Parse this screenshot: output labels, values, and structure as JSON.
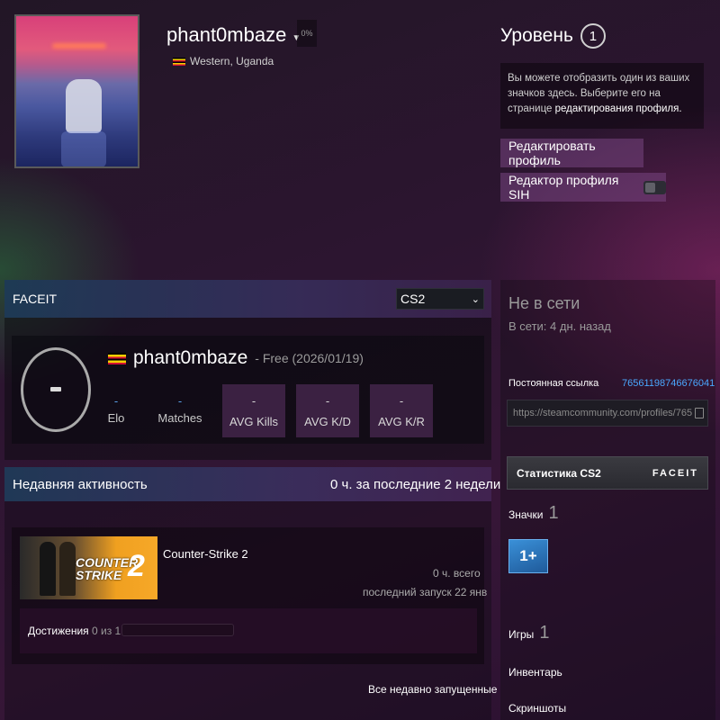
{
  "header": {
    "username": "phant0mbaze",
    "percent": "0%",
    "location": "Western, Uganda",
    "level_label": "Уровень",
    "level_value": "1",
    "badge_note": "Вы можете отобразить один из ваших значков здесь. Выберите его на странице",
    "badge_note_link": "редактирования профиля.",
    "edit_profile_button": "Редактировать профиль",
    "sih_editor_button": "Редактор профиля SIH"
  },
  "faceit": {
    "title": "FACEIT",
    "game_select": "CS2",
    "name": "phant0mbaze",
    "subtitle": "- Free (2026/01/19)",
    "stats": [
      {
        "label": "Elo",
        "value": "-"
      },
      {
        "label": "Matches",
        "value": "-"
      }
    ],
    "stat_boxes": [
      {
        "label": "AVG Kills",
        "value": "-"
      },
      {
        "label": "AVG K/D",
        "value": "-"
      },
      {
        "label": "AVG K/R",
        "value": "-"
      }
    ]
  },
  "recent": {
    "title": "Недавняя активность",
    "hours": "0 ч. за последние 2 недели",
    "game": {
      "name": "Counter-Strike 2",
      "capsule_text_1": "COUNTER",
      "capsule_text_2": "STRIKE",
      "capsule_num": "2",
      "total": "0 ч. всего",
      "last_played": "последний запуск 22 янв",
      "achievements_label": "Достижения",
      "achievements_count": "0 из 1",
      "achievements_progress": 0
    },
    "all_recent_link": "Все недавно запущенные"
  },
  "sidebar": {
    "status": "Не в сети",
    "status_sub": "В сети: 4 дн. назад",
    "permalink_label": "Постоянная ссылка",
    "permalink_id": "76561198746676041",
    "permalink_url": "https://steamcommunity.com/profiles/765",
    "cs2_stats_button": "Статистика CS2",
    "faceit_logo": "FACEIT",
    "badges_label": "Значки",
    "badges_count": "1",
    "badge_text": "1+",
    "games_label": "Игры",
    "games_count": "1",
    "inventory_link": "Инвентарь",
    "screenshots_link": "Скриншоты"
  },
  "colors": {
    "link_blue": "#4aa8ff",
    "stat_blue": "#5aa0e8",
    "faceit_orange": "#ff5500"
  }
}
